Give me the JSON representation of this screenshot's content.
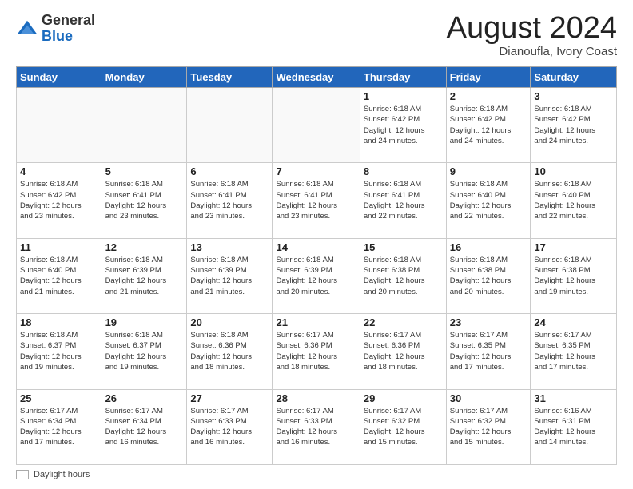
{
  "logo": {
    "general": "General",
    "blue": "Blue"
  },
  "header": {
    "month_year": "August 2024",
    "location": "Dianoufla, Ivory Coast"
  },
  "days_of_week": [
    "Sunday",
    "Monday",
    "Tuesday",
    "Wednesday",
    "Thursday",
    "Friday",
    "Saturday"
  ],
  "footer": {
    "label": "Daylight hours"
  },
  "weeks": [
    [
      {
        "day": "",
        "info": ""
      },
      {
        "day": "",
        "info": ""
      },
      {
        "day": "",
        "info": ""
      },
      {
        "day": "",
        "info": ""
      },
      {
        "day": "1",
        "info": "Sunrise: 6:18 AM\nSunset: 6:42 PM\nDaylight: 12 hours\nand 24 minutes."
      },
      {
        "day": "2",
        "info": "Sunrise: 6:18 AM\nSunset: 6:42 PM\nDaylight: 12 hours\nand 24 minutes."
      },
      {
        "day": "3",
        "info": "Sunrise: 6:18 AM\nSunset: 6:42 PM\nDaylight: 12 hours\nand 24 minutes."
      }
    ],
    [
      {
        "day": "4",
        "info": "Sunrise: 6:18 AM\nSunset: 6:42 PM\nDaylight: 12 hours\nand 23 minutes."
      },
      {
        "day": "5",
        "info": "Sunrise: 6:18 AM\nSunset: 6:41 PM\nDaylight: 12 hours\nand 23 minutes."
      },
      {
        "day": "6",
        "info": "Sunrise: 6:18 AM\nSunset: 6:41 PM\nDaylight: 12 hours\nand 23 minutes."
      },
      {
        "day": "7",
        "info": "Sunrise: 6:18 AM\nSunset: 6:41 PM\nDaylight: 12 hours\nand 23 minutes."
      },
      {
        "day": "8",
        "info": "Sunrise: 6:18 AM\nSunset: 6:41 PM\nDaylight: 12 hours\nand 22 minutes."
      },
      {
        "day": "9",
        "info": "Sunrise: 6:18 AM\nSunset: 6:40 PM\nDaylight: 12 hours\nand 22 minutes."
      },
      {
        "day": "10",
        "info": "Sunrise: 6:18 AM\nSunset: 6:40 PM\nDaylight: 12 hours\nand 22 minutes."
      }
    ],
    [
      {
        "day": "11",
        "info": "Sunrise: 6:18 AM\nSunset: 6:40 PM\nDaylight: 12 hours\nand 21 minutes."
      },
      {
        "day": "12",
        "info": "Sunrise: 6:18 AM\nSunset: 6:39 PM\nDaylight: 12 hours\nand 21 minutes."
      },
      {
        "day": "13",
        "info": "Sunrise: 6:18 AM\nSunset: 6:39 PM\nDaylight: 12 hours\nand 21 minutes."
      },
      {
        "day": "14",
        "info": "Sunrise: 6:18 AM\nSunset: 6:39 PM\nDaylight: 12 hours\nand 20 minutes."
      },
      {
        "day": "15",
        "info": "Sunrise: 6:18 AM\nSunset: 6:38 PM\nDaylight: 12 hours\nand 20 minutes."
      },
      {
        "day": "16",
        "info": "Sunrise: 6:18 AM\nSunset: 6:38 PM\nDaylight: 12 hours\nand 20 minutes."
      },
      {
        "day": "17",
        "info": "Sunrise: 6:18 AM\nSunset: 6:38 PM\nDaylight: 12 hours\nand 19 minutes."
      }
    ],
    [
      {
        "day": "18",
        "info": "Sunrise: 6:18 AM\nSunset: 6:37 PM\nDaylight: 12 hours\nand 19 minutes."
      },
      {
        "day": "19",
        "info": "Sunrise: 6:18 AM\nSunset: 6:37 PM\nDaylight: 12 hours\nand 19 minutes."
      },
      {
        "day": "20",
        "info": "Sunrise: 6:18 AM\nSunset: 6:36 PM\nDaylight: 12 hours\nand 18 minutes."
      },
      {
        "day": "21",
        "info": "Sunrise: 6:17 AM\nSunset: 6:36 PM\nDaylight: 12 hours\nand 18 minutes."
      },
      {
        "day": "22",
        "info": "Sunrise: 6:17 AM\nSunset: 6:36 PM\nDaylight: 12 hours\nand 18 minutes."
      },
      {
        "day": "23",
        "info": "Sunrise: 6:17 AM\nSunset: 6:35 PM\nDaylight: 12 hours\nand 17 minutes."
      },
      {
        "day": "24",
        "info": "Sunrise: 6:17 AM\nSunset: 6:35 PM\nDaylight: 12 hours\nand 17 minutes."
      }
    ],
    [
      {
        "day": "25",
        "info": "Sunrise: 6:17 AM\nSunset: 6:34 PM\nDaylight: 12 hours\nand 17 minutes."
      },
      {
        "day": "26",
        "info": "Sunrise: 6:17 AM\nSunset: 6:34 PM\nDaylight: 12 hours\nand 16 minutes."
      },
      {
        "day": "27",
        "info": "Sunrise: 6:17 AM\nSunset: 6:33 PM\nDaylight: 12 hours\nand 16 minutes."
      },
      {
        "day": "28",
        "info": "Sunrise: 6:17 AM\nSunset: 6:33 PM\nDaylight: 12 hours\nand 16 minutes."
      },
      {
        "day": "29",
        "info": "Sunrise: 6:17 AM\nSunset: 6:32 PM\nDaylight: 12 hours\nand 15 minutes."
      },
      {
        "day": "30",
        "info": "Sunrise: 6:17 AM\nSunset: 6:32 PM\nDaylight: 12 hours\nand 15 minutes."
      },
      {
        "day": "31",
        "info": "Sunrise: 6:16 AM\nSunset: 6:31 PM\nDaylight: 12 hours\nand 14 minutes."
      }
    ]
  ]
}
